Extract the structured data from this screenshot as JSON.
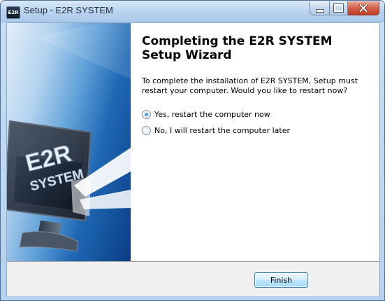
{
  "window": {
    "title": "Setup - E2R SYSTEM",
    "icon": "e2r-app-icon",
    "icon_text": "E2R"
  },
  "sidebar": {
    "image": "monitor-with-e2r-system-logo",
    "logo_line1": "E2R",
    "logo_line2": "SYSTEM"
  },
  "main": {
    "heading": "Completing the E2R SYSTEM\nSetup Wizard",
    "message": "To complete the installation of E2R SYSTEM, Setup must\nrestart your computer. Would you like to restart now?",
    "options": [
      {
        "label": "Yes, restart the computer now",
        "selected": true
      },
      {
        "label": "No, I will restart the computer later",
        "selected": false
      }
    ]
  },
  "footer": {
    "finish_label": "Finish"
  },
  "colors": {
    "accent": "#1f67b4",
    "title_bar": "#bcd5ef",
    "close_button": "#c23d24"
  }
}
